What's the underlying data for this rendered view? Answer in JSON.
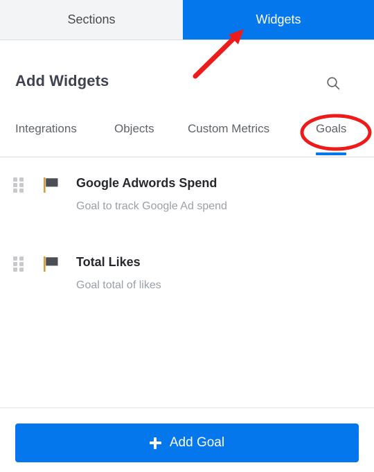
{
  "window": {
    "title": "Add Widgets"
  },
  "topbar": {
    "tabs": [
      {
        "label": "Sections",
        "active": false
      },
      {
        "label": "Widgets",
        "active": true
      }
    ]
  },
  "header": {
    "title": "Add Widgets",
    "search_icon": "search-icon"
  },
  "subtabs": {
    "items": [
      {
        "label": "Integrations",
        "active": false
      },
      {
        "label": "Objects",
        "active": false
      },
      {
        "label": "Custom Metrics",
        "active": false
      },
      {
        "label": "Goals",
        "active": true
      }
    ]
  },
  "list": {
    "items": [
      {
        "icon": "flag-icon",
        "drag_handle": "drag-handle-icon",
        "title": "Google Adwords Spend",
        "description": "Goal to track Google Ad spend"
      },
      {
        "icon": "flag-icon",
        "drag_handle": "drag-handle-icon",
        "title": "Total Likes",
        "description": "Goal total of likes"
      }
    ]
  },
  "footer": {
    "add_goal_label": "Add Goal",
    "add_goal_icon": "plus-icon"
  },
  "annotations": [
    {
      "type": "arrow",
      "target": "widgets-tab",
      "color": "#ee1b1b"
    },
    {
      "type": "ellipse",
      "target": "goals-subtab",
      "color": "#ee1b1b"
    }
  ],
  "colors": {
    "accent_blue": "#0477ec",
    "tab_inactive_bg": "#f3f4f5",
    "annotation_red": "#ee1b1b",
    "title_text": "#3f4450",
    "muted_text": "#9aa0a6"
  }
}
